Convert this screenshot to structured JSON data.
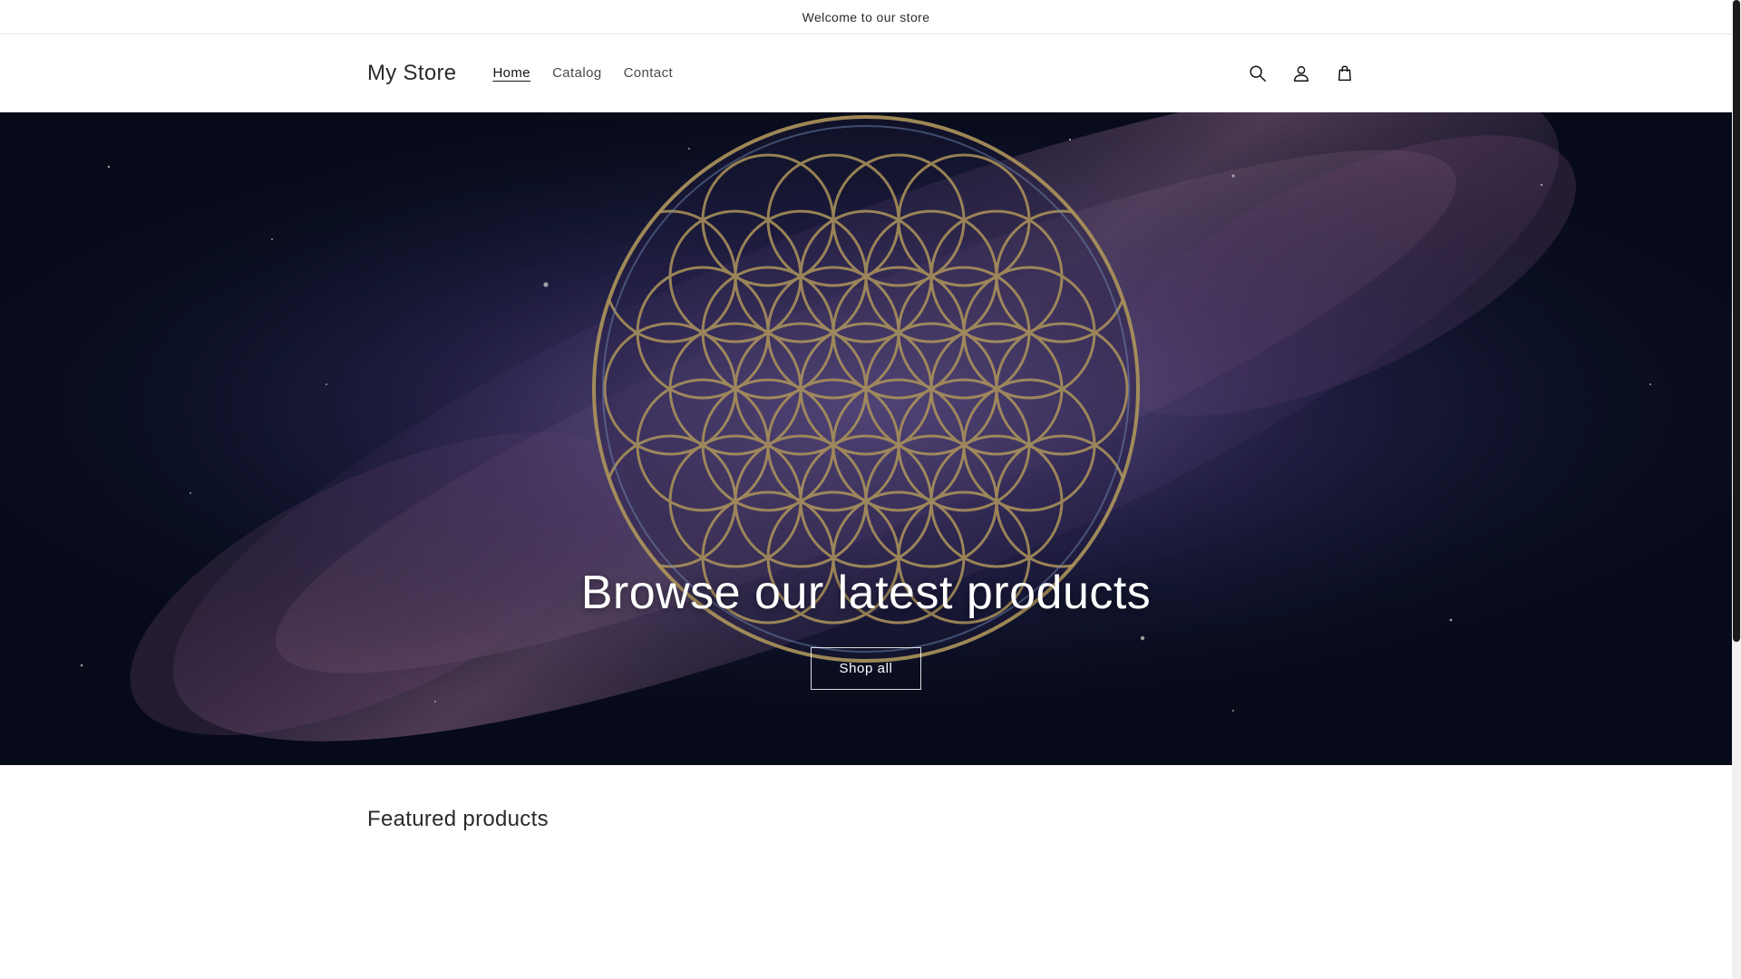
{
  "announcement": {
    "text": "Welcome to our store"
  },
  "header": {
    "logo": "My Store",
    "nav": [
      {
        "label": "Home",
        "active": true
      },
      {
        "label": "Catalog",
        "active": false
      },
      {
        "label": "Contact",
        "active": false
      }
    ],
    "icons": [
      "search-icon",
      "account-icon",
      "cart-icon"
    ]
  },
  "hero": {
    "title": "Browse our latest products",
    "button_label": "Shop all"
  },
  "featured": {
    "title": "Featured products"
  },
  "colors": {
    "text": "#121212",
    "hero_bg": "#1a1d3e",
    "gold": "#e8c77a",
    "nebula": "#b07ab0"
  }
}
